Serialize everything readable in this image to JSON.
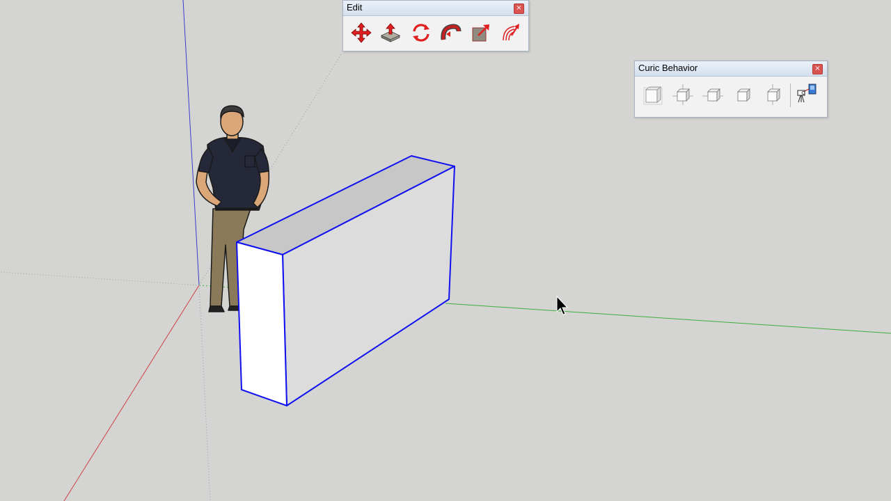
{
  "colors": {
    "background": "#d4d4d2",
    "selection": "#1010f0",
    "axis_red": "#d04040",
    "axis_green": "#3cae3c",
    "axis_blue": "#3c3cd0"
  },
  "edit_toolbar": {
    "title": "Edit",
    "close_label": "×",
    "tools": [
      {
        "icon": "move-icon"
      },
      {
        "icon": "push-pull-icon"
      },
      {
        "icon": "rotate-icon"
      },
      {
        "icon": "follow-me-icon"
      },
      {
        "icon": "scale-icon"
      },
      {
        "icon": "offset-icon"
      }
    ]
  },
  "curic_toolbar": {
    "title": "Curic Behavior",
    "close_label": "×",
    "tools": [
      {
        "icon": "box-all-faces-icon"
      },
      {
        "icon": "box-top-axis-icon"
      },
      {
        "icon": "box-side-axis-icon"
      },
      {
        "icon": "box-front-icon"
      },
      {
        "icon": "box-vertical-axis-icon"
      },
      {
        "icon": "camera-projector-icon"
      }
    ]
  },
  "scene": {
    "figure": "person-figure",
    "object": "selected-box",
    "cursor": "arrow-cursor"
  }
}
